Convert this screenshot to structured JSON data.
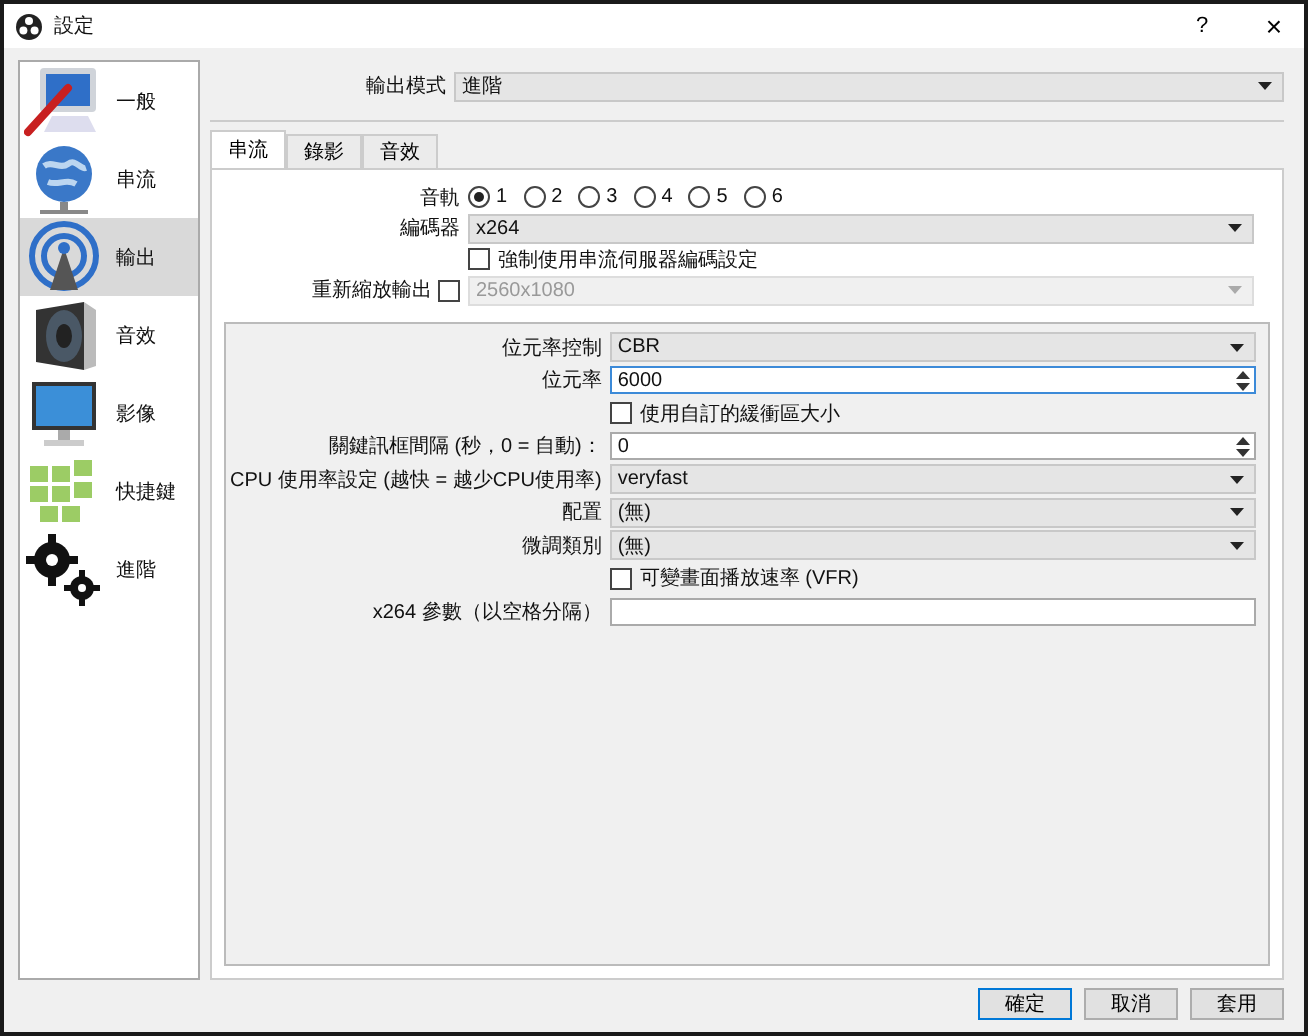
{
  "window": {
    "title": "設定",
    "help_button": "?",
    "close_button": "×"
  },
  "sidebar": {
    "items": [
      {
        "kind": "general",
        "label": "一般",
        "selected": false
      },
      {
        "kind": "stream",
        "label": "串流",
        "selected": false
      },
      {
        "kind": "output",
        "label": "輸出",
        "selected": true
      },
      {
        "kind": "audio",
        "label": "音效",
        "selected": false
      },
      {
        "kind": "video",
        "label": "影像",
        "selected": false
      },
      {
        "kind": "hotkeys",
        "label": "快捷鍵",
        "selected": false
      },
      {
        "kind": "advanced",
        "label": "進階",
        "selected": false
      }
    ]
  },
  "output_mode": {
    "label": "輸出模式",
    "value": "進階"
  },
  "tabs": [
    {
      "label": "串流",
      "selected": true
    },
    {
      "label": "錄影",
      "selected": false
    },
    {
      "label": "音效",
      "selected": false
    }
  ],
  "audio_track": {
    "label": "音軌",
    "options": [
      {
        "label": "1",
        "selected": true
      },
      {
        "label": "2",
        "selected": false
      },
      {
        "label": "3",
        "selected": false
      },
      {
        "label": "4",
        "selected": false
      },
      {
        "label": "5",
        "selected": false
      },
      {
        "label": "6",
        "selected": false
      }
    ]
  },
  "encoder": {
    "label": "編碼器",
    "value": "x264"
  },
  "enforce_encoder_settings": {
    "label": "強制使用串流伺服器編碼設定",
    "checked": false
  },
  "rescale_output": {
    "label": "重新縮放輸出",
    "checked": false,
    "value": "2560x1080",
    "disabled": true
  },
  "encoder_settings": {
    "rows": [
      {
        "kind": "dropdown",
        "label": "位元率控制",
        "value": "CBR"
      },
      {
        "kind": "spin",
        "label": "位元率",
        "value": "6000",
        "focused": true
      },
      {
        "kind": "checkbox",
        "label": "使用自訂的緩衝區大小",
        "checked": false
      },
      {
        "kind": "spin",
        "label": "關鍵訊框間隔 (秒，0 = 自動)：",
        "value": "0",
        "focused": false
      },
      {
        "kind": "dropdown",
        "label": "CPU 使用率設定 (越快 = 越少CPU使用率)",
        "value": "veryfast"
      },
      {
        "kind": "dropdown",
        "label": "配置",
        "value": "(無)"
      },
      {
        "kind": "dropdown",
        "label": "微調類別",
        "value": "(無)"
      },
      {
        "kind": "checkbox",
        "label": "可變畫面播放速率 (VFR)",
        "checked": false
      },
      {
        "kind": "text",
        "label": "x264 參數（以空格分隔）"
      }
    ]
  },
  "buttons": [
    {
      "label": "確定",
      "default": true
    },
    {
      "label": "取消",
      "default": false
    },
    {
      "label": "套用",
      "default": false
    }
  ]
}
